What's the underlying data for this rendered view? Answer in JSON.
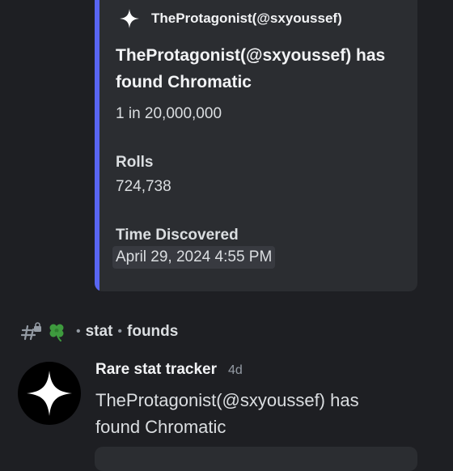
{
  "embed": {
    "author_name": "TheProtagonist(@sxyoussef)",
    "title": "TheProtagonist(@sxyoussef) has found Chromatic",
    "description": "1 in 20,000,000",
    "fields": [
      {
        "name": "Rolls",
        "value": "724,738"
      },
      {
        "name": "Time Discovered",
        "value": "April 29, 2024 4:55 PM"
      }
    ],
    "accent_color": "#5865f2"
  },
  "reference": {
    "icons": [
      "hashtag-lock-icon",
      "four-leaf-clover-icon"
    ],
    "separator": "•",
    "channel": "stat",
    "subchannel": "founds"
  },
  "message": {
    "author": "Rare stat tracker",
    "timestamp": "4d",
    "body": "TheProtagonist(@sxyoussef) has found Chromatic",
    "avatar_icon": "sparkle-star-icon"
  }
}
